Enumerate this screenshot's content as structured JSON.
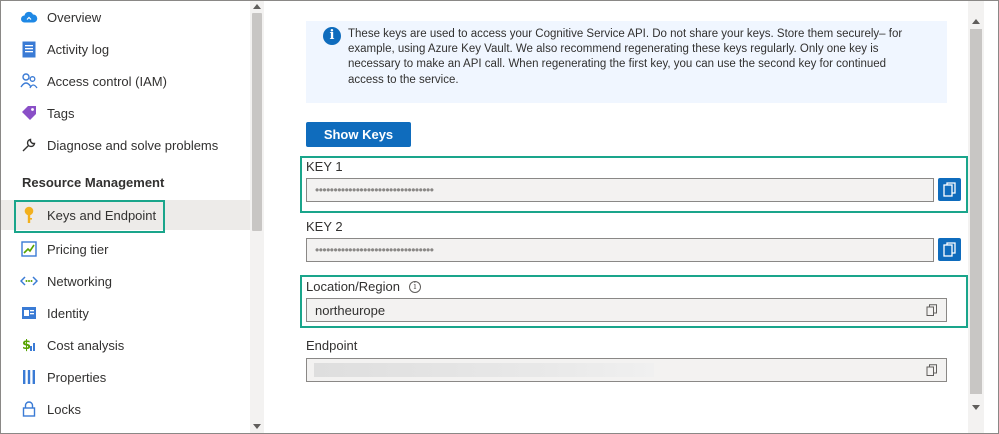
{
  "sidebar": {
    "items": [
      {
        "label": "Overview",
        "icon": "cloud-icon"
      },
      {
        "label": "Activity log",
        "icon": "document-log-icon"
      },
      {
        "label": "Access control (IAM)",
        "icon": "people-icon"
      },
      {
        "label": "Tags",
        "icon": "tag-icon"
      },
      {
        "label": "Diagnose and solve problems",
        "icon": "wrench-icon"
      },
      {
        "label": "Keys and Endpoint",
        "icon": "key-icon",
        "selected": true
      },
      {
        "label": "Pricing tier",
        "icon": "pricing-tier-icon"
      },
      {
        "label": "Networking",
        "icon": "networking-icon"
      },
      {
        "label": "Identity",
        "icon": "identity-icon"
      },
      {
        "label": "Cost analysis",
        "icon": "cost-analysis-icon"
      },
      {
        "label": "Properties",
        "icon": "properties-icon"
      },
      {
        "label": "Locks",
        "icon": "lock-icon"
      }
    ],
    "section_heading": "Resource Management"
  },
  "main": {
    "info_text": "These keys are used to access your Cognitive Service API. Do not share your keys. Store them securely– for example, using Azure Key Vault. We also recommend regenerating these keys regularly. Only one key is necessary to make an API call. When regenerating the first key, you can use the second key for continued access to the service.",
    "show_keys_label": "Show Keys",
    "key1": {
      "label": "KEY 1",
      "value": "••••••••••••••••••••••••••••••••"
    },
    "key2": {
      "label": "KEY 2",
      "value": "••••••••••••••••••••••••••••••••"
    },
    "location": {
      "label": "Location/Region",
      "value": "northeurope"
    },
    "endpoint": {
      "label": "Endpoint",
      "value": ""
    }
  },
  "colors": {
    "accent": "#0f6cbd",
    "highlight": "#1aa58b",
    "info_background": "#f0f6ff"
  }
}
